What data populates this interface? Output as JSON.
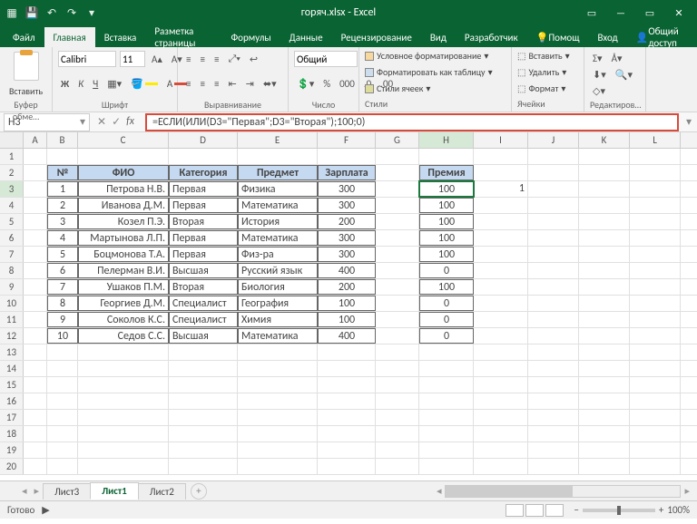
{
  "app": {
    "title": "горяч.xlsx - Excel"
  },
  "win": {
    "min": "—",
    "acct": "🗖",
    "full": "▭",
    "close": "✕"
  },
  "tabs": {
    "file": "Файл",
    "home": "Главная",
    "insert": "Вставка",
    "layout": "Разметка страницы",
    "formulas": "Формулы",
    "data": "Данные",
    "review": "Рецензирование",
    "view": "Вид",
    "dev": "Разработчик",
    "help": "Помощ",
    "signin": "Вход",
    "share": "Общий доступ"
  },
  "ribbon": {
    "clipboard": {
      "label": "Буфер обме…",
      "paste": "Вставить"
    },
    "font": {
      "label": "Шрифт",
      "name": "Calibri",
      "size": "11"
    },
    "align": {
      "label": "Выравнивание"
    },
    "number": {
      "label": "Число",
      "format": "Общий"
    },
    "styles": {
      "label": "Стили",
      "cond": "Условное форматирование",
      "table": "Форматировать как таблицу",
      "cell": "Стили ячеек"
    },
    "cells": {
      "label": "Ячейки",
      "insert": "Вставить",
      "delete": "Удалить",
      "format": "Формат"
    },
    "editing": {
      "label": "Редактиров…"
    }
  },
  "namebox": "H3",
  "formula": "=ЕСЛИ(ИЛИ(D3=\"Первая\";D3=\"Вторая\");100;0)",
  "columns": [
    "A",
    "B",
    "C",
    "D",
    "E",
    "F",
    "G",
    "H",
    "I",
    "J",
    "K",
    "L"
  ],
  "headers": {
    "num": "№",
    "fio": "ФИО",
    "cat": "Категория",
    "subj": "Предмет",
    "sal": "Зарплата",
    "bonus": "Премия"
  },
  "rows": [
    {
      "n": 1,
      "fio": "Петрова Н.В.",
      "cat": "Первая",
      "subj": "Физика",
      "sal": 300,
      "bonus": 100
    },
    {
      "n": 2,
      "fio": "Иванова Д.М.",
      "cat": "Первая",
      "subj": "Математика",
      "sal": 300,
      "bonus": 100
    },
    {
      "n": 3,
      "fio": "Козел П.Э.",
      "cat": "Вторая",
      "subj": "История",
      "sal": 200,
      "bonus": 100
    },
    {
      "n": 4,
      "fio": "Мартынова Л.П.",
      "cat": "Первая",
      "subj": "Математика",
      "sal": 300,
      "bonus": 100
    },
    {
      "n": 5,
      "fio": "Боцмонова Т.А.",
      "cat": "Первая",
      "subj": "Физ-ра",
      "sal": 300,
      "bonus": 100
    },
    {
      "n": 6,
      "fio": "Пелерман В.И.",
      "cat": "Высшая",
      "subj": "Русский язык",
      "sal": 400,
      "bonus": 0
    },
    {
      "n": 7,
      "fio": "Ушаков П.М.",
      "cat": "Вторая",
      "subj": "Биология",
      "sal": 200,
      "bonus": 100
    },
    {
      "n": 8,
      "fio": "Георгиев Д.М.",
      "cat": "Специалист",
      "subj": "География",
      "sal": 100,
      "bonus": 0
    },
    {
      "n": 9,
      "fio": "Соколов К.С.",
      "cat": "Специалист",
      "subj": "Химия",
      "sal": 100,
      "bonus": 0
    },
    {
      "n": 10,
      "fio": "Седов С.С.",
      "cat": "Высшая",
      "subj": "Математика",
      "sal": 400,
      "bonus": 0
    }
  ],
  "i3": "1",
  "sheets": {
    "s3": "Лист3",
    "s1": "Лист1",
    "s2": "Лист2"
  },
  "status": {
    "ready": "Готово",
    "zoom": "100%"
  }
}
